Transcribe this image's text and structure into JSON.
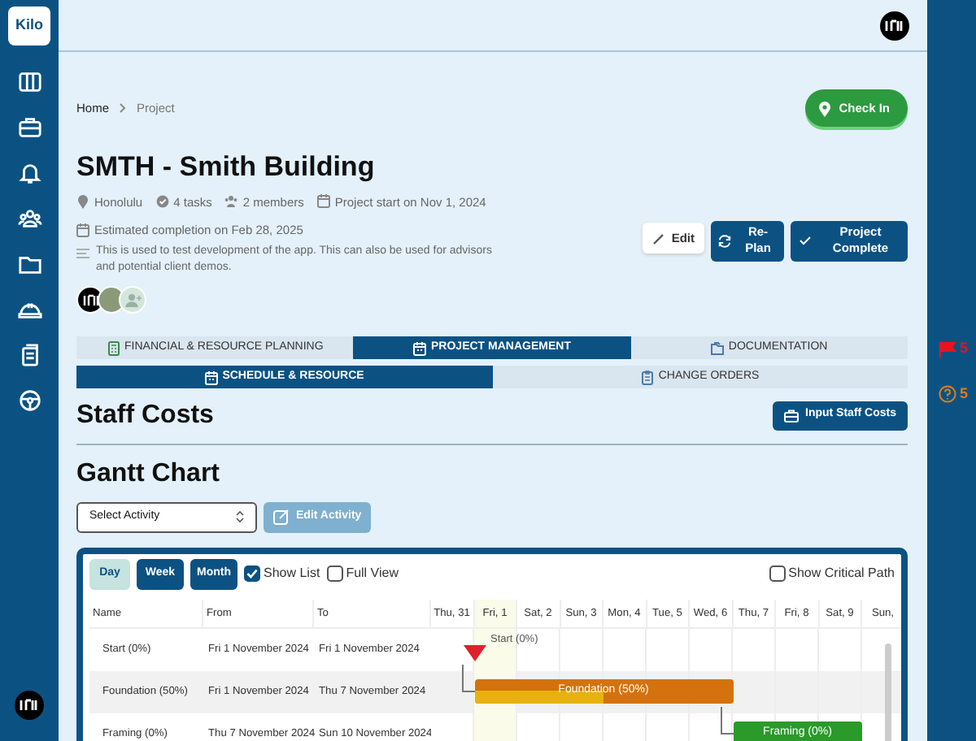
{
  "app": {
    "logo": "Kilo"
  },
  "breadcrumb": [
    {
      "label": "Home",
      "current": false
    },
    {
      "label": "Project",
      "current": true
    }
  ],
  "check_in": {
    "label": "Check In"
  },
  "project": {
    "title": "SMTH - Smith Building",
    "meta": [
      {
        "kind": "location",
        "text": "Honolulu"
      },
      {
        "kind": "tasks",
        "text": "4 tasks"
      },
      {
        "kind": "members",
        "text": "2 members"
      },
      {
        "kind": "calendar",
        "text": "Project start on Nov 1, 2024"
      }
    ],
    "estimated": "Estimated completion on Feb 28, 2025",
    "description": "This is used to test development of the app. This can also be used for advisors and potential client demos."
  },
  "actions": [
    {
      "kind": "edit",
      "label": "Edit"
    },
    {
      "kind": "replan",
      "label": "Re-Plan"
    },
    {
      "kind": "complete",
      "label": "Project Complete"
    }
  ],
  "members": [
    {
      "kind": "logo"
    },
    {
      "kind": "photo"
    },
    {
      "kind": "add"
    }
  ],
  "tabs": [
    {
      "kind": "finance",
      "label": "FINANCIAL & RESOURCE PLANNING",
      "selected": false
    },
    {
      "kind": "calendar",
      "label": "PROJECT MANAGEMENT",
      "selected": true
    },
    {
      "kind": "folder",
      "label": "DOCUMENTATION",
      "selected": false
    }
  ],
  "subtabs": [
    {
      "kind": "calendar",
      "label": "SCHEDULE & RESOURCE",
      "selected": true
    },
    {
      "kind": "clipboard",
      "label": "CHANGE ORDERS",
      "selected": false
    }
  ],
  "staff_costs": {
    "title": "Staff Costs",
    "button": "Input Staff Costs"
  },
  "gantt": {
    "title": "Gantt Chart",
    "select": {
      "value": "Select Activity"
    },
    "edit_button": {
      "label": "Edit Activity",
      "disabled": true
    },
    "view_buttons": [
      {
        "label": "Day",
        "selected": true
      },
      {
        "label": "Week",
        "selected": false
      },
      {
        "label": "Month",
        "selected": false
      }
    ],
    "options": [
      {
        "label": "Show List",
        "checked": true
      },
      {
        "label": "Full View",
        "checked": false
      }
    ],
    "critical_path": {
      "label": "Show Critical Path",
      "checked": false
    },
    "columns": [
      "Name",
      "From",
      "To"
    ],
    "days": [
      {
        "label": "Thu, 31",
        "highlighted": false
      },
      {
        "label": "Fri, 1",
        "highlighted": true
      },
      {
        "label": "Sat, 2",
        "highlighted": false
      },
      {
        "label": "Sun, 3",
        "highlighted": false
      },
      {
        "label": "Mon, 4",
        "highlighted": false
      },
      {
        "label": "Tue, 5",
        "highlighted": false
      },
      {
        "label": "Wed, 6",
        "highlighted": false
      },
      {
        "label": "Thu, 7",
        "highlighted": false
      },
      {
        "label": "Fri, 8",
        "highlighted": false
      },
      {
        "label": "Sat, 9",
        "highlighted": false
      },
      {
        "label": "Sun,",
        "highlighted": false
      }
    ],
    "tasks": [
      {
        "name": "Start (0%)",
        "from": "Fri 1 November 2024",
        "to": "Fri 1 November 2024",
        "kind": "milestone",
        "bar_label": "Start (0%)",
        "color": "#e0202a",
        "linked": false
      },
      {
        "name": "Foundation (50%)",
        "from": "Fri 1 November 2024",
        "to": "Thu 7 November 2024",
        "kind": "task",
        "bar_label": "Foundation (50%)",
        "color": "#d4720d",
        "level": 0.5,
        "linked": true
      },
      {
        "name": "Framing (0%)",
        "from": "Thu 7 November 2024",
        "to": "Sun 10 November 2024",
        "kind": "task",
        "bar_label": "Framing (0%)",
        "color": "#2a9a2a",
        "level": 0,
        "linked": true
      }
    ]
  },
  "alerts": [
    {
      "kind": "flag",
      "count": "5",
      "color": "#e8141b"
    },
    {
      "kind": "help",
      "count": "5",
      "color": "#e07b1a"
    }
  ]
}
